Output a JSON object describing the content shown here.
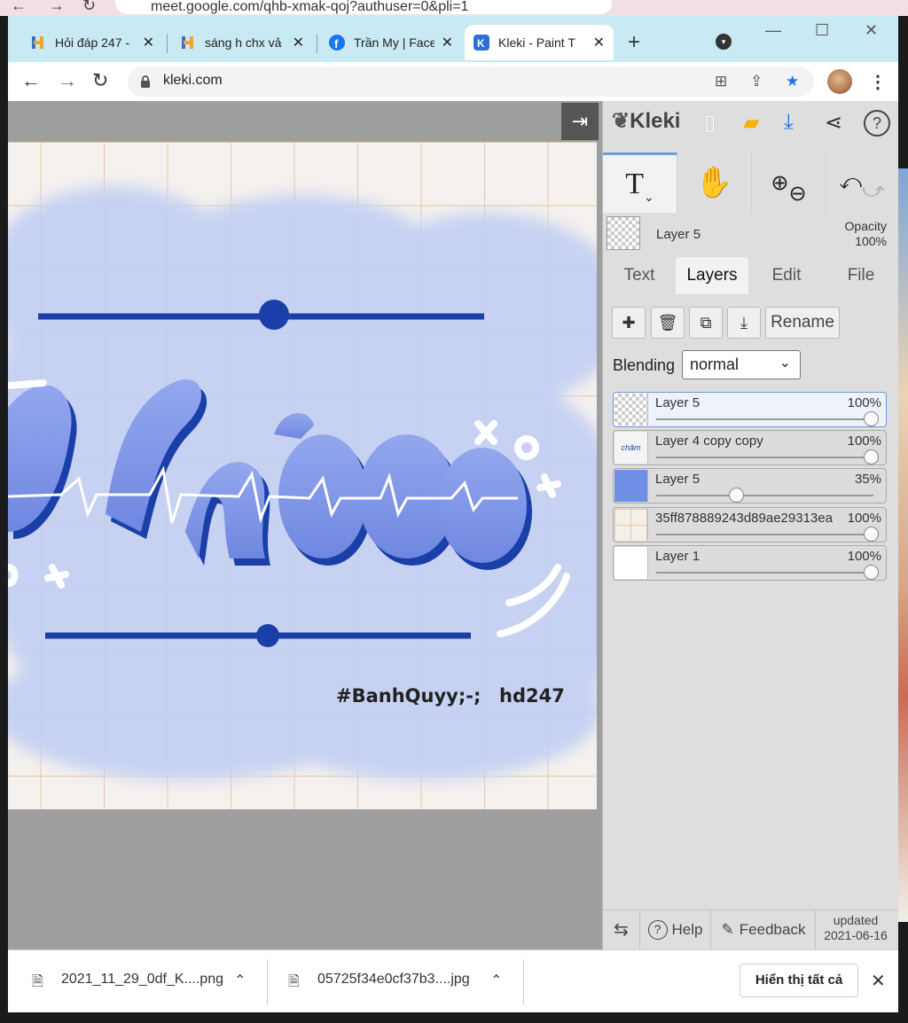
{
  "outer": {
    "url": "meet.google.com/qhb-xmak-qoj?authuser=0&pli=1"
  },
  "tabs": [
    {
      "title": "Hỏi đáp 247 -",
      "icon": "hoidap-favicon"
    },
    {
      "title": "sáng h chx vả",
      "icon": "hoidap-favicon"
    },
    {
      "title": "Trần My | Face",
      "icon": "facebook-icon"
    },
    {
      "title": "Kleki - Paint T",
      "icon": "kleki-favicon",
      "active": true
    }
  ],
  "address": {
    "url": "kleki.com"
  },
  "app": {
    "logo": "Kleki",
    "current_layer": "Layer 5",
    "opacity_label": "Opacity",
    "opacity_value": "100%",
    "panel_tabs": [
      "Text",
      "Layers",
      "Edit",
      "File"
    ],
    "selected_tab": "Layers",
    "rename_label": "Rename",
    "blending_label": "Blending",
    "blending_value": "normal",
    "layers": [
      {
        "name": "Layer 5",
        "opacity": "100%",
        "selected": true
      },
      {
        "name": "Layer 4 copy copy",
        "opacity": "100%"
      },
      {
        "name": "Layer 5",
        "opacity": "35%"
      },
      {
        "name": "35ff878889243d89ae29313ea",
        "opacity": "100%"
      },
      {
        "name": "Layer 1",
        "opacity": "100%"
      }
    ],
    "footer": {
      "help": "Help",
      "feedback": "Feedback",
      "updated_line1": "updated",
      "updated_line2": "2021-06-16"
    },
    "canvas": {
      "word": "chăm",
      "signature_left": "#BanhQuyy;-;",
      "signature_right": "hd247"
    }
  },
  "downloads": {
    "items": [
      "2021_11_29_0df_K....png",
      "05725f34e0cf37b3....jpg"
    ],
    "show_all": "Hiển thị tất cả"
  },
  "colors": {
    "accent": "#1a3fa8",
    "light_blue": "#c8d4f4",
    "grid": "#e6c9a8"
  }
}
